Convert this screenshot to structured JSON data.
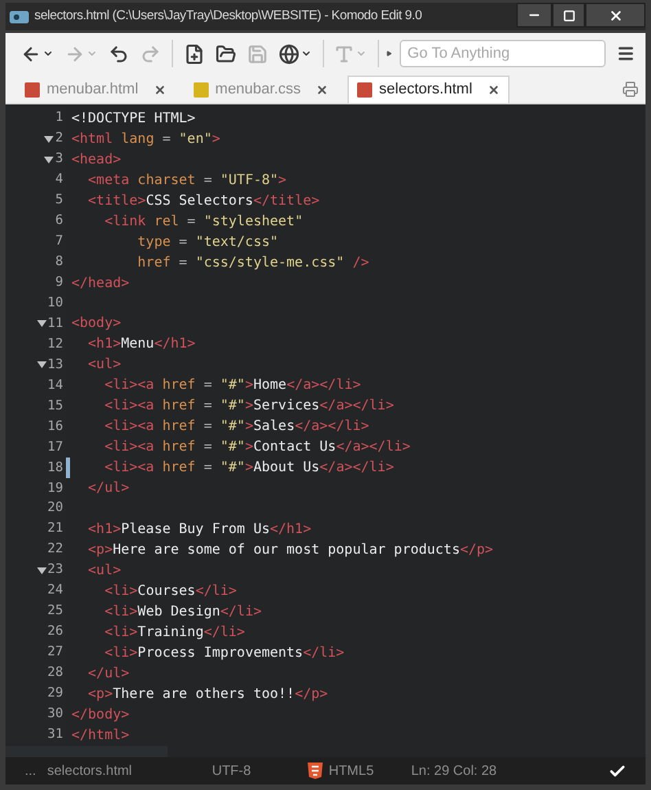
{
  "window": {
    "title": "selectors.html (C:\\Users\\JayTray\\Desktop\\WEBSITE) - Komodo Edit 9.0"
  },
  "toolbar": [
    {
      "kind": "back",
      "disabled": false,
      "dropdown": true
    },
    {
      "kind": "forward",
      "disabled": true,
      "dropdown": true
    },
    {
      "kind": "undo",
      "disabled": false,
      "dropdown": false
    },
    {
      "kind": "redo",
      "disabled": true,
      "dropdown": false
    },
    {
      "kind": "new-file",
      "disabled": false,
      "dropdown": false
    },
    {
      "kind": "open-folder",
      "disabled": false,
      "dropdown": false
    },
    {
      "kind": "save",
      "disabled": true,
      "dropdown": false
    },
    {
      "kind": "globe",
      "disabled": false,
      "dropdown": true
    },
    {
      "kind": "font",
      "disabled": true,
      "dropdown": true
    }
  ],
  "search": {
    "placeholder": "Go To Anything"
  },
  "tabs": [
    {
      "label": "menubar.html",
      "kind": "html",
      "selected": false
    },
    {
      "label": "menubar.css",
      "kind": "css",
      "selected": false
    },
    {
      "label": "selectors.html",
      "kind": "html",
      "selected": true
    }
  ],
  "lines": [
    {
      "number": "1",
      "foldable": false,
      "marked": false,
      "tokens": [
        {
          "kind": "text",
          "text": "<!DOCTYPE HTML>"
        }
      ]
    },
    {
      "number": "2",
      "foldable": true,
      "marked": false,
      "tokens": [
        {
          "kind": "tag",
          "text": "<html"
        },
        {
          "kind": "attr",
          "text": " lang"
        },
        {
          "kind": "op",
          "text": " = "
        },
        {
          "kind": "str",
          "text": "\"en\""
        },
        {
          "kind": "tag",
          "text": ">"
        }
      ]
    },
    {
      "number": "3",
      "foldable": true,
      "marked": false,
      "tokens": [
        {
          "kind": "tag",
          "text": "<head>"
        }
      ]
    },
    {
      "number": "4",
      "foldable": false,
      "marked": false,
      "tokens": [
        {
          "kind": "tag",
          "text": "  <meta"
        },
        {
          "kind": "attr",
          "text": " charset"
        },
        {
          "kind": "op",
          "text": " = "
        },
        {
          "kind": "str",
          "text": "\"UTF-8\""
        },
        {
          "kind": "tag",
          "text": ">"
        }
      ]
    },
    {
      "number": "5",
      "foldable": false,
      "marked": false,
      "tokens": [
        {
          "kind": "tag",
          "text": "  <title>"
        },
        {
          "kind": "text",
          "text": "CSS Selectors"
        },
        {
          "kind": "tag",
          "text": "</title>"
        }
      ]
    },
    {
      "number": "6",
      "foldable": false,
      "marked": false,
      "tokens": [
        {
          "kind": "tag",
          "text": "    <link"
        },
        {
          "kind": "attr",
          "text": " rel"
        },
        {
          "kind": "op",
          "text": " = "
        },
        {
          "kind": "str",
          "text": "\"stylesheet\""
        }
      ]
    },
    {
      "number": "7",
      "foldable": false,
      "marked": false,
      "tokens": [
        {
          "kind": "attr",
          "text": "        type"
        },
        {
          "kind": "op",
          "text": " = "
        },
        {
          "kind": "str",
          "text": "\"text/css\""
        }
      ]
    },
    {
      "number": "8",
      "foldable": false,
      "marked": false,
      "tokens": [
        {
          "kind": "attr",
          "text": "        href"
        },
        {
          "kind": "op",
          "text": " = "
        },
        {
          "kind": "str",
          "text": "\"css/style-me.css\""
        },
        {
          "kind": "tag",
          "text": " />"
        }
      ]
    },
    {
      "number": "9",
      "foldable": false,
      "marked": false,
      "tokens": [
        {
          "kind": "tag",
          "text": "</head>"
        }
      ]
    },
    {
      "number": "10",
      "foldable": false,
      "marked": false
    },
    {
      "number": "11",
      "foldable": true,
      "marked": false,
      "tokens": [
        {
          "kind": "tag",
          "text": "<body>"
        }
      ]
    },
    {
      "number": "12",
      "foldable": false,
      "marked": false,
      "tokens": [
        {
          "kind": "tag",
          "text": "  <h1>"
        },
        {
          "kind": "text",
          "text": "Menu"
        },
        {
          "kind": "tag",
          "text": "</h1>"
        }
      ]
    },
    {
      "number": "13",
      "foldable": true,
      "marked": false,
      "tokens": [
        {
          "kind": "tag",
          "text": "  <ul>"
        }
      ]
    },
    {
      "number": "14",
      "foldable": false,
      "marked": false,
      "tokens": [
        {
          "kind": "tag",
          "text": "    <li><a"
        },
        {
          "kind": "attr",
          "text": " href"
        },
        {
          "kind": "op",
          "text": " = "
        },
        {
          "kind": "str",
          "text": "\"#\""
        },
        {
          "kind": "tag",
          "text": ">"
        },
        {
          "kind": "text",
          "text": "Home"
        },
        {
          "kind": "tag",
          "text": "</a></li>"
        }
      ]
    },
    {
      "number": "15",
      "foldable": false,
      "marked": false,
      "tokens": [
        {
          "kind": "tag",
          "text": "    <li><a"
        },
        {
          "kind": "attr",
          "text": " href"
        },
        {
          "kind": "op",
          "text": " = "
        },
        {
          "kind": "str",
          "text": "\"#\""
        },
        {
          "kind": "tag",
          "text": ">"
        },
        {
          "kind": "text",
          "text": "Services"
        },
        {
          "kind": "tag",
          "text": "</a></li>"
        }
      ]
    },
    {
      "number": "16",
      "foldable": false,
      "marked": false,
      "tokens": [
        {
          "kind": "tag",
          "text": "    <li><a"
        },
        {
          "kind": "attr",
          "text": " href"
        },
        {
          "kind": "op",
          "text": " = "
        },
        {
          "kind": "str",
          "text": "\"#\""
        },
        {
          "kind": "tag",
          "text": ">"
        },
        {
          "kind": "text",
          "text": "Sales"
        },
        {
          "kind": "tag",
          "text": "</a></li>"
        }
      ]
    },
    {
      "number": "17",
      "foldable": false,
      "marked": false,
      "tokens": [
        {
          "kind": "tag",
          "text": "    <li><a"
        },
        {
          "kind": "attr",
          "text": " href"
        },
        {
          "kind": "op",
          "text": " = "
        },
        {
          "kind": "str",
          "text": "\"#\""
        },
        {
          "kind": "tag",
          "text": ">"
        },
        {
          "kind": "text",
          "text": "Contact Us"
        },
        {
          "kind": "tag",
          "text": "</a></li>"
        }
      ]
    },
    {
      "number": "18",
      "foldable": false,
      "marked": true,
      "tokens": [
        {
          "kind": "tag",
          "text": "    <li><a"
        },
        {
          "kind": "attr",
          "text": " href"
        },
        {
          "kind": "op",
          "text": " = "
        },
        {
          "kind": "str",
          "text": "\"#\""
        },
        {
          "kind": "tag",
          "text": ">"
        },
        {
          "kind": "text",
          "text": "About Us"
        },
        {
          "kind": "tag",
          "text": "</a></li>"
        }
      ]
    },
    {
      "number": "19",
      "foldable": false,
      "marked": false,
      "tokens": [
        {
          "kind": "tag",
          "text": "  </ul>"
        }
      ]
    },
    {
      "number": "20",
      "foldable": false,
      "marked": false
    },
    {
      "number": "21",
      "foldable": false,
      "marked": false,
      "tokens": [
        {
          "kind": "tag",
          "text": "  <h1>"
        },
        {
          "kind": "text",
          "text": "Please Buy From Us"
        },
        {
          "kind": "tag",
          "text": "</h1>"
        }
      ]
    },
    {
      "number": "22",
      "foldable": false,
      "marked": false,
      "tokens": [
        {
          "kind": "tag",
          "text": "  <p>"
        },
        {
          "kind": "text",
          "text": "Here are some of our most popular products"
        },
        {
          "kind": "tag",
          "text": "</p>"
        }
      ]
    },
    {
      "number": "23",
      "foldable": true,
      "marked": false,
      "tokens": [
        {
          "kind": "tag",
          "text": "  <ul>"
        }
      ]
    },
    {
      "number": "24",
      "foldable": false,
      "marked": false,
      "tokens": [
        {
          "kind": "tag",
          "text": "    <li>"
        },
        {
          "kind": "text",
          "text": "Courses"
        },
        {
          "kind": "tag",
          "text": "</li>"
        }
      ]
    },
    {
      "number": "25",
      "foldable": false,
      "marked": false,
      "tokens": [
        {
          "kind": "tag",
          "text": "    <li>"
        },
        {
          "kind": "text",
          "text": "Web Design"
        },
        {
          "kind": "tag",
          "text": "</li>"
        }
      ]
    },
    {
      "number": "26",
      "foldable": false,
      "marked": false,
      "tokens": [
        {
          "kind": "tag",
          "text": "    <li>"
        },
        {
          "kind": "text",
          "text": "Training"
        },
        {
          "kind": "tag",
          "text": "</li>"
        }
      ]
    },
    {
      "number": "27",
      "foldable": false,
      "marked": false,
      "tokens": [
        {
          "kind": "tag",
          "text": "    <li>"
        },
        {
          "kind": "text",
          "text": "Process Improvements"
        },
        {
          "kind": "tag",
          "text": "</li>"
        }
      ]
    },
    {
      "number": "28",
      "foldable": false,
      "marked": false,
      "tokens": [
        {
          "kind": "tag",
          "text": "  </ul>"
        }
      ]
    },
    {
      "number": "29",
      "foldable": false,
      "marked": false,
      "tokens": [
        {
          "kind": "tag",
          "text": "  <p>"
        },
        {
          "kind": "text",
          "text": "There are others too!!"
        },
        {
          "kind": "tag",
          "text": "</p>"
        }
      ]
    },
    {
      "number": "30",
      "foldable": false,
      "marked": false,
      "tokens": [
        {
          "kind": "tag",
          "text": "</body>"
        }
      ]
    },
    {
      "number": "31",
      "foldable": false,
      "marked": false,
      "tokens": [
        {
          "kind": "tag",
          "text": "</html>"
        }
      ]
    }
  ],
  "status_bar": {
    "ellipsis": "...",
    "file": "selectors.html",
    "encoding": "UTF-8",
    "language": "HTML5",
    "position": "Ln: 29 Col: 28"
  }
}
